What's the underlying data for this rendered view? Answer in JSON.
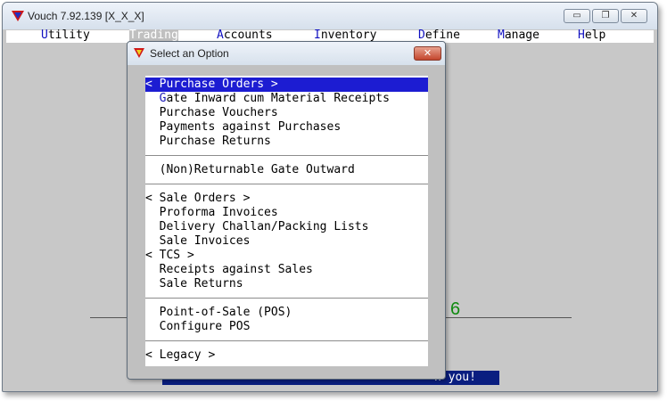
{
  "window": {
    "title": "Vouch  7.92.139  [X_X_X]",
    "controls": {
      "minimize": "▭",
      "maximize": "❐",
      "close": "✕"
    }
  },
  "menubar": [
    {
      "label": "Utility",
      "hotkey": "U",
      "rest": "tility"
    },
    {
      "label": "Trading",
      "hotkey": "",
      "rest": "Trading"
    },
    {
      "label": "Accounts",
      "hotkey": "A",
      "rest": "ccounts"
    },
    {
      "label": "Inventory",
      "hotkey": "I",
      "rest": "nventory"
    },
    {
      "label": "Define",
      "hotkey": "D",
      "rest": "efine"
    },
    {
      "label": "Manage",
      "hotkey": "M",
      "rest": "anage"
    },
    {
      "label": "Help",
      "hotkey": "H",
      "rest": "elp"
    }
  ],
  "background": {
    "big_number": "6",
    "status_text": "n you!"
  },
  "dialog": {
    "title": "Select an Option",
    "close": "✕",
    "options": [
      {
        "pre": "< ",
        "hk": "P",
        "post": "urchase Orders >",
        "selected": true
      },
      {
        "pre": "  ",
        "hk": "G",
        "post": "ate Inward cum Material Receipts"
      },
      {
        "pre": "  ",
        "hk": "",
        "post": "Purchase Vouchers",
        "mid": {
          "a": "P",
          "b": "u",
          "c": "rchase Vouchers"
        }
      },
      {
        "pre": "  ",
        "hk": "",
        "post": "Payments against Purchases"
      },
      {
        "pre": "  ",
        "hk": "",
        "post": "Purchase Returns"
      },
      {
        "pre": "  ",
        "hk": "",
        "post": "(Non)Returnable Gate Outward"
      },
      {
        "pre": "< ",
        "hk": "",
        "post": "Sale Orders >"
      },
      {
        "pre": "  ",
        "hk": "",
        "post": "Proforma Invoices"
      },
      {
        "pre": "  ",
        "hk": "",
        "post": "Delivery Challan/Packing Lists"
      },
      {
        "pre": "  ",
        "hk": "",
        "post": "Sale Invoices"
      },
      {
        "pre": "< ",
        "hk": "",
        "post": "TCS >"
      },
      {
        "pre": "  ",
        "hk": "",
        "post": "Receipts against Sales"
      },
      {
        "pre": "  ",
        "hk": "",
        "post": "Sale Returns"
      },
      {
        "pre": "  ",
        "hk": "",
        "post": "Point-of-Sale (POS)"
      },
      {
        "pre": "  ",
        "hk": "",
        "post": "Configure POS"
      },
      {
        "pre": "< ",
        "hk": "",
        "post": "Legacy >"
      }
    ]
  },
  "colors": {
    "selection": "#1c1cd2",
    "hotkey": "#1a1ab8",
    "status_bar": "#0a1e80",
    "number": "#0f8a0f"
  }
}
